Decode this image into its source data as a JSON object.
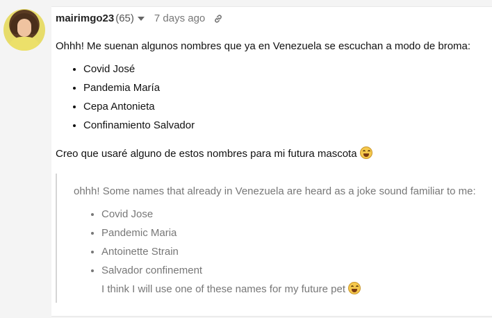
{
  "post": {
    "username": "mairimgo23",
    "reputation": "(65)",
    "timestamp": "7 days ago",
    "intro": "Ohhh! Me suenan algunos nombres que ya en Venezuela se escuchan a modo de broma:",
    "names": [
      "Covid José",
      "Pandemia María",
      "Cepa Antonieta",
      "Confinamiento Salvador"
    ],
    "closing": "Creo que usaré alguno de estos nombres para mi futura mascota"
  },
  "quote": {
    "intro": "ohhh! Some names that already in Venezuela are heard as a joke sound familiar to me:",
    "names": [
      "Covid Jose",
      "Pandemic Maria",
      "Antoinette Strain",
      "Salvador confinement"
    ],
    "closing": "I think I will use one of these names for my future pet"
  },
  "icons": {
    "caret": "chevron-down-icon",
    "link": "link-icon",
    "emoji": "laughing-emoji-icon"
  },
  "colors": {
    "card_bg": "#ffffff",
    "page_bg": "#f4f4f4",
    "quote_text": "#777777",
    "quote_border": "#d5d5d5"
  }
}
